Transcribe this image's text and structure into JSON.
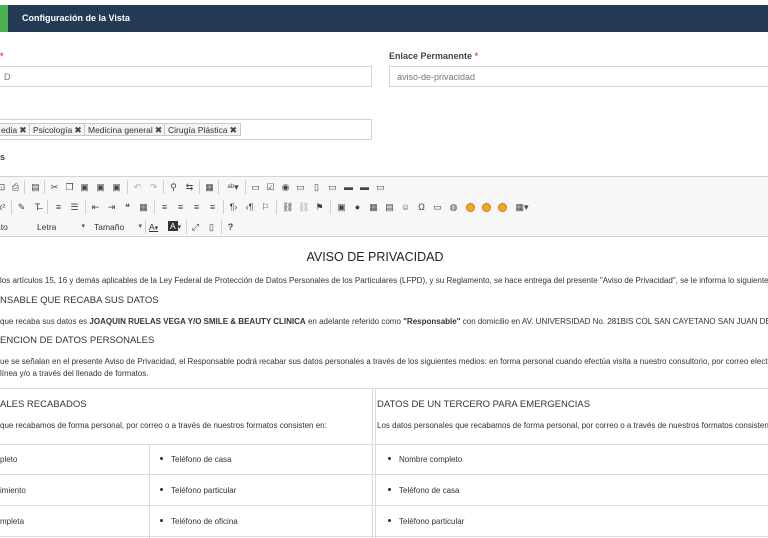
{
  "header": {
    "title": "Configuración de la Vista",
    "accent_color": "#4caf50",
    "bar_color": "#253a54"
  },
  "form": {
    "left_label_required": "*",
    "left_value": "D",
    "permalink_label": "Enlace Permanente",
    "permalink_required": "*",
    "permalink_value": "aviso-de-privacidad",
    "tags": [
      {
        "label": "edia",
        "remove": "✖"
      },
      {
        "label": "Psicología",
        "remove": "✖"
      },
      {
        "label": "Medicina general",
        "remove": "✖"
      },
      {
        "label": "Cirugía Plástica",
        "remove": "✖"
      }
    ],
    "third_label_fragment": "s"
  },
  "toolbar": {
    "font_combo": "ato",
    "letter_combo": "Letra",
    "size_combo": "Tamaño",
    "font_color_label": "A",
    "bg_color_label": "A",
    "help_label": "?",
    "omega": "Ω"
  },
  "document": {
    "title": "AVISO DE PRIVACIDAD",
    "intro": "los artículos 15, 16 y demás aplicables de la Ley Federal de Protección de Datos Personales de los Particulares (LFPD), y su Reglamento, se hace entrega del presente \"Aviso de Privacidad\", se le informa lo siguiente:",
    "section1_heading": "NSABLE QUE RECABA SUS DATOS",
    "section1_pre": "que recaba sus datos es ",
    "section1_bold": "JOAQUIN RUELAS VEGA Y/O SMILE & BEAUTY CLINICA",
    "section1_mid": " en adelante referido como ",
    "section1_bold2": "\"Responsable\"",
    "section1_post": " con domicilio en AV. UNIVERSIDAD No. 281BIS COL SAN CAYETANO SAN JUAN DEL RIO, Q",
    "section2_heading": "ENCION DE DATOS PERSONALES",
    "section2_line1": "ue se señalan en el presente Aviso de Privacidad, el Responsable podrá recabar sus datos personales a través de los siguientes medios: en forma personal cuando efectúa visita a nuestro consultorio, por correo electrónic",
    "section2_line2": "línea y/o a través del llenado de formatos.",
    "table": {
      "left_heading": "ALES RECABADOS",
      "left_sub": " que recabamos de forma personal, por correo o a través de nuestros formatos consisten en:",
      "right_heading": "DATOS DE UN TERCERO PARA EMERGENCIAS",
      "right_sub": "Los datos personales que recabamos de forma personal, por correo o a través de nuestros formatos consisten en:",
      "rows": [
        {
          "c1": "pleto",
          "c2": "Teléfono de casa",
          "c3": "Nombre completo"
        },
        {
          "c1": "imiento",
          "c2": "Teléfono particular",
          "c3": "Teléfono de casa"
        },
        {
          "c1": "mpleta",
          "c2": "Teléfono de oficina",
          "c3": "Teléfono particular"
        }
      ]
    }
  }
}
